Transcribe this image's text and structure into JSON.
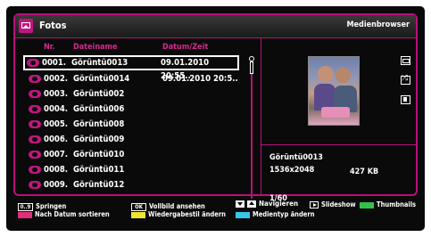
{
  "header": {
    "title": "Fotos",
    "right_title": "Medienbrowser"
  },
  "columns": {
    "nr": "Nr.",
    "name": "Dateiname",
    "date": "Datum/Zeit"
  },
  "rows": [
    {
      "nr": "0001.",
      "name": "Görüntü0013",
      "date": "09.01.2010 20:55..",
      "selected": true
    },
    {
      "nr": "0002.",
      "name": "Görüntü0014",
      "date": "09.01.2010 20:5.."
    },
    {
      "nr": "0003.",
      "name": "Görüntü002",
      "date": ""
    },
    {
      "nr": "0004.",
      "name": "Görüntü006",
      "date": ""
    },
    {
      "nr": "0005.",
      "name": "Görüntü008",
      "date": ""
    },
    {
      "nr": "0006.",
      "name": "Görüntü009",
      "date": ""
    },
    {
      "nr": "0007.",
      "name": "Görüntü010",
      "date": ""
    },
    {
      "nr": "0008.",
      "name": "Görüntü011",
      "date": ""
    },
    {
      "nr": "0009.",
      "name": "Görüntü012",
      "date": ""
    }
  ],
  "info": {
    "filename": "Görüntü0013",
    "resolution": "1536x2048",
    "size": "427 KB",
    "page": "1/60"
  },
  "footer": {
    "jump_key": "0..9",
    "jump": "Springen",
    "ok_key": "OK",
    "fullscreen": "Vollbild ansehen",
    "navigate": "Navigieren",
    "slideshow": "Slideshow",
    "thumbnails": "Thumbnails",
    "sort_by_date": "Nach Datum sortieren",
    "change_style": "Wiedergabestil ändern",
    "change_media_type": "Medientyp ändern"
  },
  "colors": {
    "accent": "#b8117c",
    "heading": "#d52a8e",
    "red": "#e0307a",
    "yellow": "#f0e530",
    "cyan": "#37c6e8",
    "green": "#34c04c"
  },
  "icons": [
    "photo-app-icon",
    "loop-icon",
    "shuffle-icon",
    "stop-icon"
  ]
}
